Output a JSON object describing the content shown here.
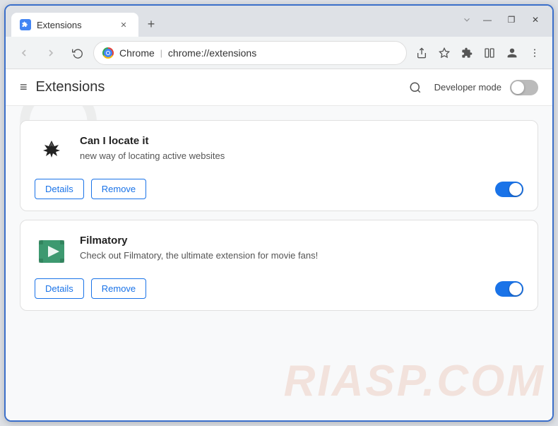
{
  "browser": {
    "tab": {
      "title": "Extensions",
      "icon_label": "puzzle-icon"
    },
    "new_tab_label": "+",
    "window_controls": {
      "minimize": "—",
      "maximize": "❐",
      "close": "✕"
    },
    "nav": {
      "back_label": "←",
      "forward_label": "→",
      "reload_label": "↻",
      "brand": "Chrome",
      "address": "chrome://extensions",
      "share_label": "⬆",
      "bookmark_label": "☆",
      "extensions_label": "⚙",
      "profile_label": "👤",
      "menu_label": "⋮"
    }
  },
  "page": {
    "menu_icon": "≡",
    "title": "Extensions",
    "search_label": "🔍",
    "dev_mode_label": "Developer mode"
  },
  "extensions": [
    {
      "id": "can-locate-it",
      "name": "Can I locate it",
      "description": "new way of locating active websites",
      "details_label": "Details",
      "remove_label": "Remove",
      "enabled": true
    },
    {
      "id": "filmatory",
      "name": "Filmatory",
      "description": "Check out Filmatory, the ultimate extension for movie fans!",
      "details_label": "Details",
      "remove_label": "Remove",
      "enabled": true
    }
  ],
  "watermark_text": "RIASP.COM"
}
